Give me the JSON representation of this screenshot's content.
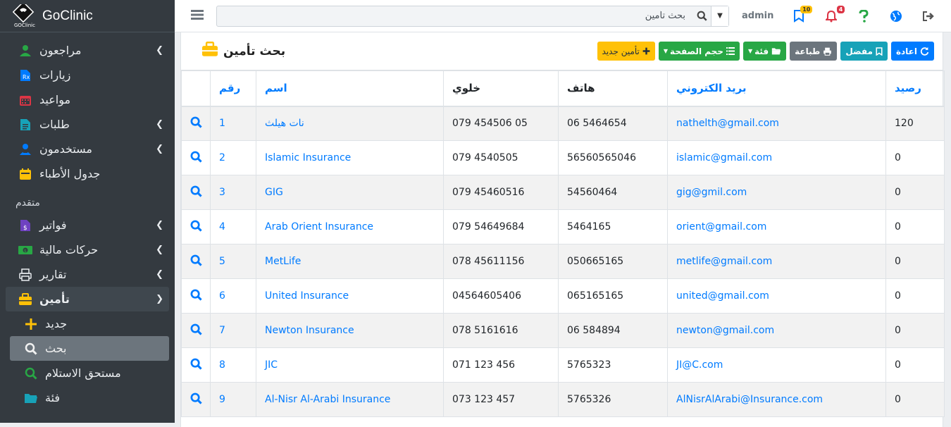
{
  "app": {
    "name": "GoClinic",
    "logo_text": "GOClinic"
  },
  "sidebar": {
    "items": [
      {
        "label": "مراجعون",
        "icon": "user-icon",
        "chevron": true
      },
      {
        "label": "زيارات",
        "icon": "file-medical-icon",
        "chevron": false
      },
      {
        "label": "مواعيد",
        "icon": "calendar-icon",
        "chevron": false
      },
      {
        "label": "طلبات",
        "icon": "file-list-icon",
        "chevron": true
      },
      {
        "label": "مستخدمون",
        "icon": "users-icon",
        "chevron": true
      },
      {
        "label": "جدول الأطباء",
        "icon": "calendar-check-icon",
        "chevron": false
      }
    ],
    "header": "متقدم",
    "advanced": [
      {
        "label": "فواتير",
        "icon": "invoice-icon",
        "chevron": true
      },
      {
        "label": "حركات مالية",
        "icon": "money-icon",
        "chevron": true
      },
      {
        "label": "تقارير",
        "icon": "print-icon",
        "chevron": true
      },
      {
        "label": "تأمين",
        "icon": "briefcase-icon",
        "chevron": true
      }
    ],
    "sub": [
      {
        "label": "جديد",
        "icon": "plus-icon"
      },
      {
        "label": "بحث",
        "icon": "search-icon"
      },
      {
        "label": "مستحق الاستلام",
        "icon": "search-icon"
      },
      {
        "label": "فئة",
        "icon": "folder-icon"
      }
    ]
  },
  "topbar": {
    "search_value": "بحث تأمين",
    "user": "admin",
    "flag_badge": "10",
    "bell_badge": "4"
  },
  "page": {
    "title": "بحث تأمين",
    "buttons": {
      "new": "تأمين جديد",
      "page_size": "حجم الصفحة",
      "category": "فئة",
      "print": "طباعة",
      "favorite": "مفضل",
      "reload": "اعادة"
    }
  },
  "table": {
    "headers": {
      "id": "رقم",
      "name": "اسم",
      "mobile": "خلوي",
      "phone": "هاتف",
      "email": "بريد الكتروني",
      "balance": "رصيد"
    },
    "rows": [
      {
        "id": "1",
        "name": "نات هيلث",
        "mobile": "079 454506 05",
        "phone": "06 5464654",
        "email": "nathelth@gmail.com",
        "balance": "120"
      },
      {
        "id": "2",
        "name": "Islamic Insurance",
        "mobile": "079 4540505",
        "phone": "56560565046",
        "email": "islamic@gmail.com",
        "balance": "0"
      },
      {
        "id": "3",
        "name": "GIG",
        "mobile": "079 45460516",
        "phone": "54560464",
        "email": "gig@gmil.com",
        "balance": "0"
      },
      {
        "id": "4",
        "name": "Arab Orient Insurance",
        "mobile": "079 54649684",
        "phone": "5464165",
        "email": "orient@gmail.com",
        "balance": "0"
      },
      {
        "id": "5",
        "name": "MetLife",
        "mobile": "078 45611156",
        "phone": "050665165",
        "email": "metlife@gmail.com",
        "balance": "0"
      },
      {
        "id": "6",
        "name": "United Insurance",
        "mobile": "04564605406",
        "phone": "065165165",
        "email": "united@gmail.com",
        "balance": "0"
      },
      {
        "id": "7",
        "name": "Newton Insurance",
        "mobile": "078 5161616",
        "phone": "06 584894",
        "email": "newton@gmail.com",
        "balance": "0"
      },
      {
        "id": "8",
        "name": "JIC",
        "mobile": "071 123 456",
        "phone": "5765323",
        "email": "JI@C.com",
        "balance": "0"
      },
      {
        "id": "9",
        "name": "Al-Nisr Al-Arabi Insurance",
        "mobile": "073 123 457",
        "phone": "5765326",
        "email": "AlNisrAlArabi@Insurance.com",
        "balance": "0"
      }
    ]
  },
  "colors": {
    "sidebar_bg": "#343a40",
    "primary": "#007bff",
    "success": "#28a745",
    "warning": "#ffc107",
    "info": "#17a2b8",
    "secondary": "#6c757d"
  }
}
